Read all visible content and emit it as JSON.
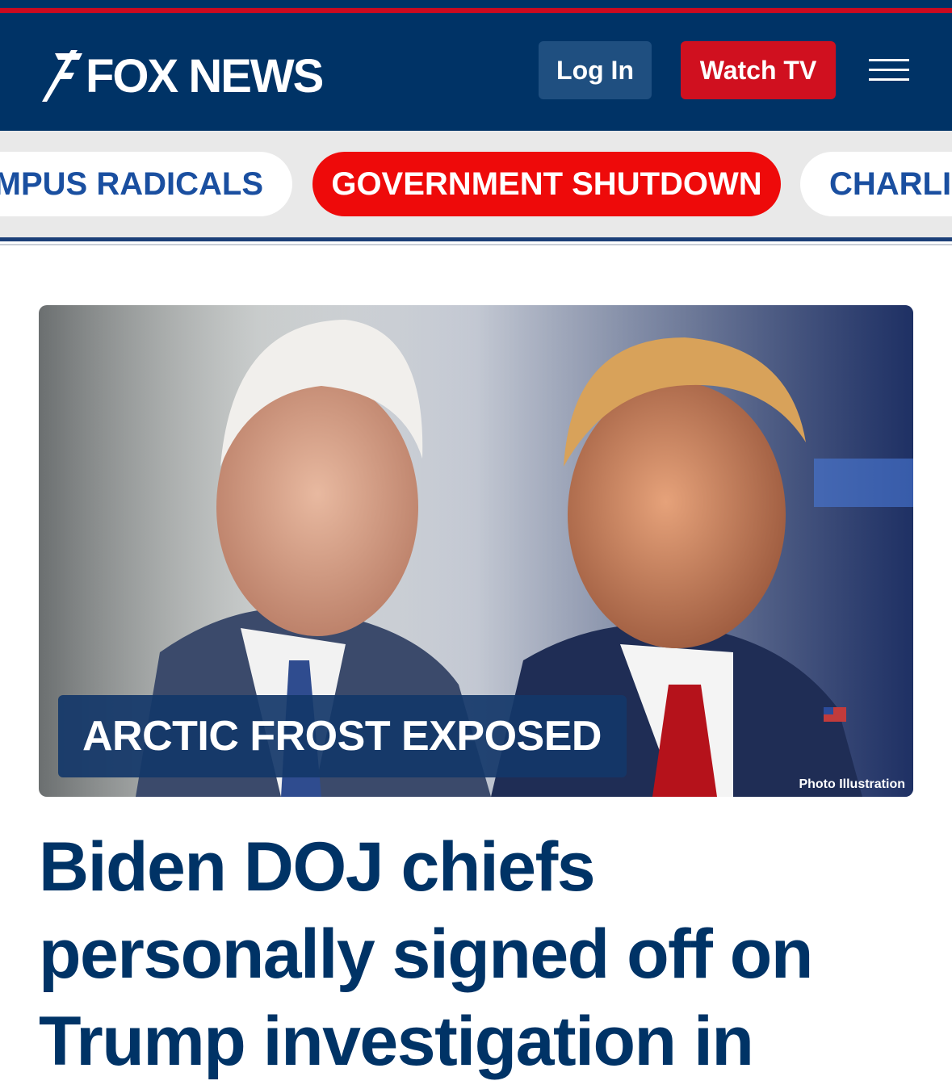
{
  "header": {
    "logo_text": "FOX NEWS",
    "login_label": "Log In",
    "watch_label": "Watch TV",
    "brand_blue": "#003366",
    "brand_red": "#d0101f"
  },
  "topics": [
    {
      "label": "AMPUS RADICALS",
      "style": "white"
    },
    {
      "label": "GOVERNMENT SHUTDOWN",
      "style": "red"
    },
    {
      "label": "CHARLIE",
      "style": "white"
    }
  ],
  "hero": {
    "label": "ARCTIC FROST EXPOSED",
    "credit": "Photo Illustration"
  },
  "headline": "Biden DOJ chiefs personally signed off on Trump investigation in"
}
